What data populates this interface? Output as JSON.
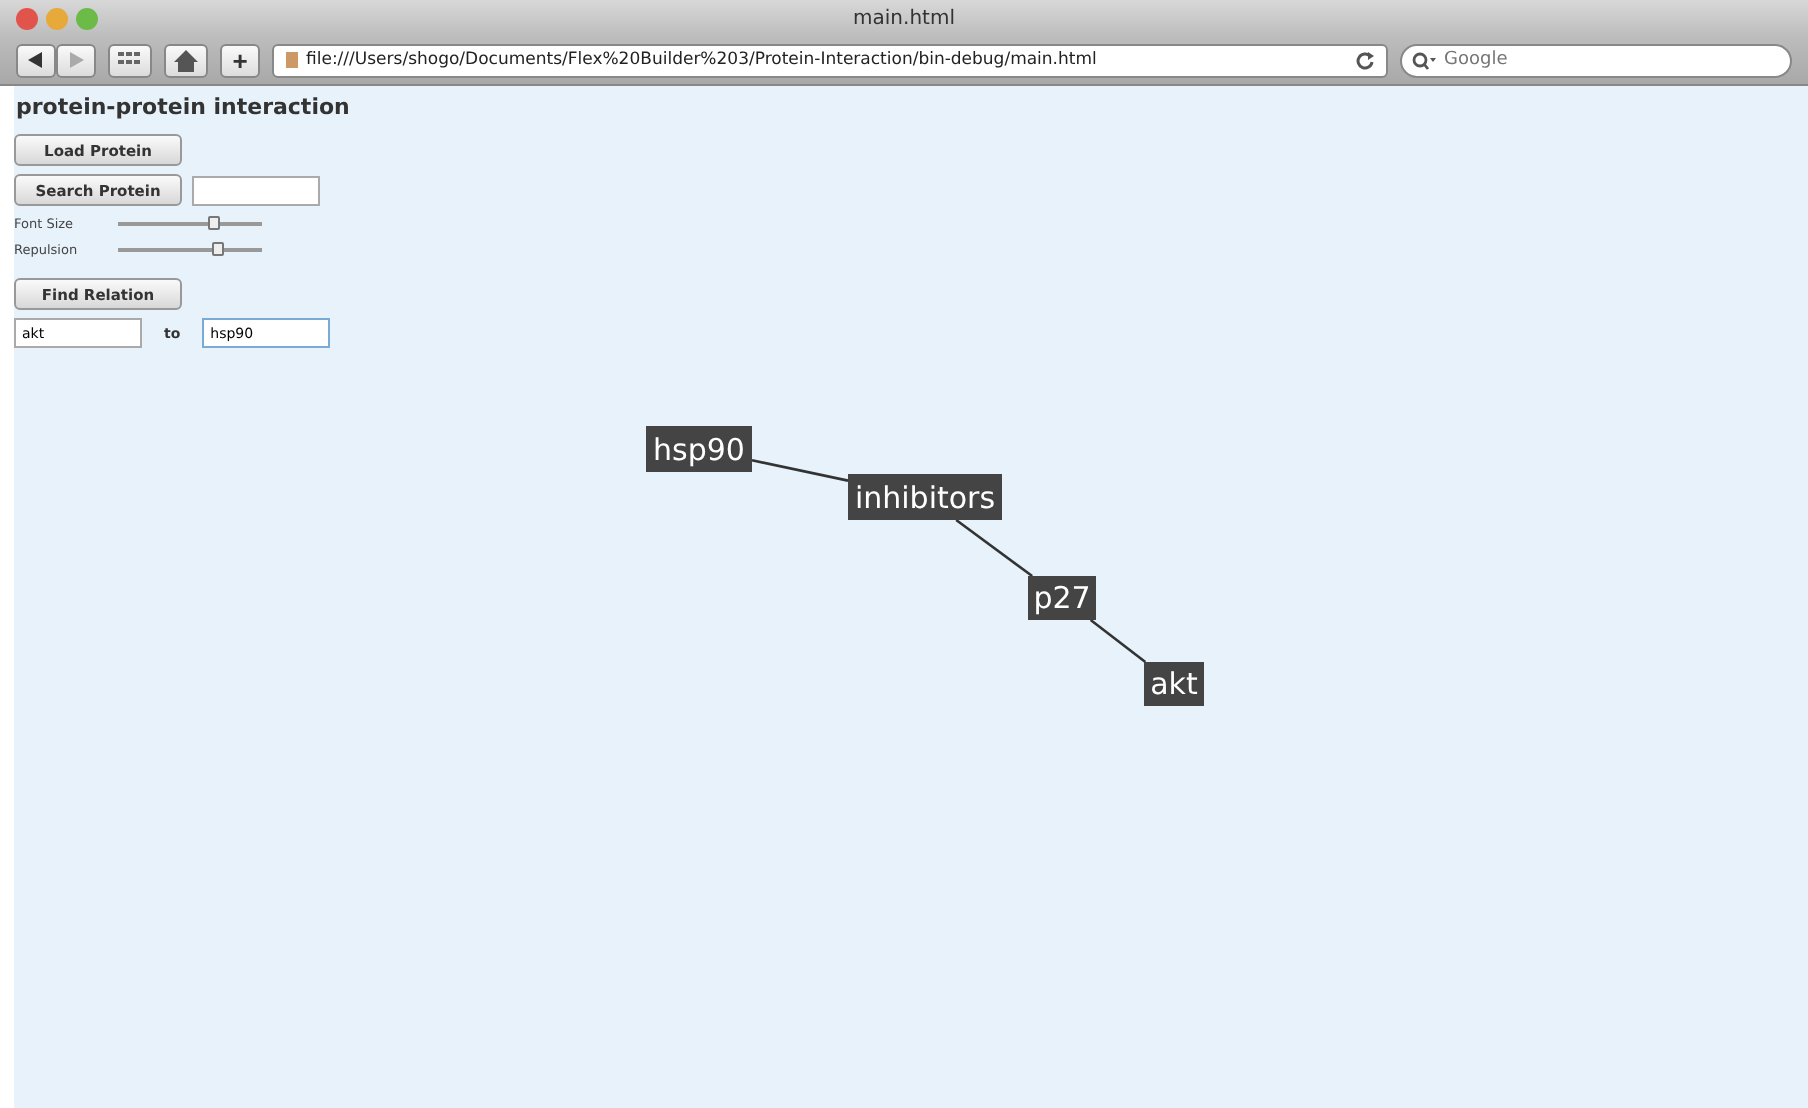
{
  "window": {
    "title": "main.html"
  },
  "toolbar": {
    "address": "file:///Users/shogo/Documents/Flex%20Builder%203/Protein-Interaction/bin-debug/main.html",
    "search_placeholder": "Google",
    "plus": "+"
  },
  "page": {
    "heading": "protein-protein interaction",
    "load_button": "Load Protein",
    "search_button": "Search Protein",
    "sliders": [
      {
        "label": "Font Size",
        "level": 0.67
      },
      {
        "label": "Repulsion",
        "level": 0.7
      }
    ],
    "find_button": "Find Relation",
    "from_value": "akt",
    "to_label": "to",
    "to_value": "hsp90"
  },
  "graph": {
    "nodes": [
      {
        "label": "hsp90"
      },
      {
        "label": "inhibitors"
      },
      {
        "label": "p27"
      },
      {
        "label": "akt"
      }
    ]
  }
}
